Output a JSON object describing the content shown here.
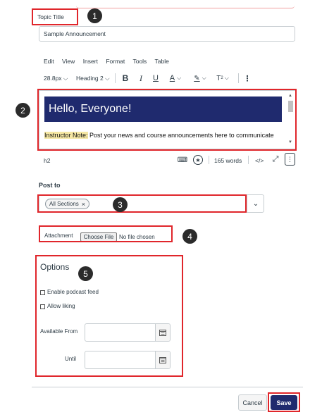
{
  "topic": {
    "label": "Topic Title",
    "value": "Sample Announcement"
  },
  "editor": {
    "menu": [
      "Edit",
      "View",
      "Insert",
      "Format",
      "Tools",
      "Table"
    ],
    "font_size": "28.8px",
    "heading": "Heading 2",
    "heading_text": "Hello, Everyone!",
    "note_label": "Instructor Note:",
    "note_text": " Post your news and course announcements here to communicate",
    "status_tag": "h2",
    "word_count": "165 words",
    "html_toggle": "</>"
  },
  "post_to": {
    "label": "Post to",
    "chip": "All Sections",
    "chip_remove": "×"
  },
  "attachment": {
    "label": "Attachment",
    "button": "Choose File",
    "status": "No file chosen"
  },
  "options": {
    "title": "Options",
    "podcast": "Enable podcast feed",
    "liking": "Allow liking",
    "available_from": "Available From",
    "until": "Until"
  },
  "actions": {
    "cancel": "Cancel",
    "save": "Save"
  },
  "badges": [
    "1",
    "2",
    "3",
    "4",
    "5"
  ],
  "colors": {
    "banner": "#1f2a6e",
    "highlight": "#f5e7a3",
    "annotation": "#e0262b",
    "save": "#1f2a6e"
  }
}
